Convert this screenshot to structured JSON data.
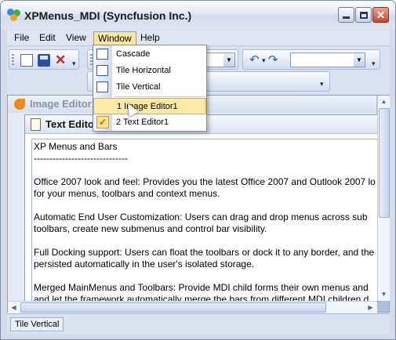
{
  "window": {
    "title": "XPMenus_MDI (Syncfusion Inc.)"
  },
  "menubar": {
    "items": [
      "File",
      "Edit",
      "View",
      "Window",
      "Help"
    ],
    "active": "Window"
  },
  "toolbar": {
    "icons": [
      "new-document-icon",
      "save-icon",
      "delete-icon",
      "undo-icon",
      "redo-icon"
    ]
  },
  "window_menu": {
    "items": [
      {
        "label": "Cascade",
        "icon": "cascade-icon"
      },
      {
        "label": "Tile Horizontal",
        "icon": "tile-horizontal-icon"
      },
      {
        "label": "Tile Vertical",
        "icon": "tile-vertical-icon"
      },
      {
        "label": "1 Image Editor1",
        "highlighted": true
      },
      {
        "label": "2 Text Editor1",
        "checked": true
      }
    ]
  },
  "children": {
    "image_editor": {
      "title": "Image Editor1"
    },
    "text_editor": {
      "title": "Text Editor",
      "content": "XP Menus and Bars\n------------------------------\n\nOffice 2007 look and feel: Provides you the latest Office 2007 and Outlook 2007 lo\nfor your menus, toolbars and context menus.\n\nAutomatic End User Customization: Users can drag and drop menus across sub\ntoolbars, create new submenus and control bar visibility.\n\nFull Docking support: Users can float the toolbars or dock it to any border, and the\npersisted automatically in the user's isolated storage.\n\nMerged MainMenus and Toolbars: Provide MDI child forms their own menus and\nand let the framework automatically merge the bars from different MDI children d"
    }
  },
  "statusbar": {
    "text": "Tile Vertical"
  },
  "colors": {
    "menu_highlight": "#fde9a3",
    "titlebar": "#dfe6f1",
    "accent": "#2e5bb3"
  }
}
